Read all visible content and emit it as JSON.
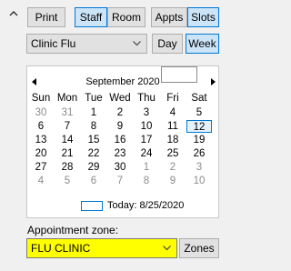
{
  "toolbar": {
    "print": "Print",
    "staff": "Staff",
    "room": "Room",
    "appts": "Appts",
    "slots": "Slots"
  },
  "filter": {
    "clinic": "Clinic Flu",
    "day": "Day",
    "week": "Week"
  },
  "calendar": {
    "month": "September 2020",
    "weekdays": [
      "Sun",
      "Mon",
      "Tue",
      "Wed",
      "Thu",
      "Fri",
      "Sat"
    ],
    "weeks": [
      [
        "30",
        "31",
        "1",
        "2",
        "3",
        "4",
        "5"
      ],
      [
        "6",
        "7",
        "8",
        "9",
        "10",
        "11",
        "12"
      ],
      [
        "13",
        "14",
        "15",
        "16",
        "17",
        "18",
        "19"
      ],
      [
        "20",
        "21",
        "22",
        "23",
        "24",
        "25",
        "26"
      ],
      [
        "27",
        "28",
        "29",
        "30",
        "1",
        "2",
        "3"
      ],
      [
        "4",
        "5",
        "6",
        "7",
        "8",
        "9",
        "10"
      ]
    ],
    "today": "Today: 8/25/2020"
  },
  "zone": {
    "label": "Appointment zone:",
    "value": "FLU CLINIC",
    "zones_button": "Zones",
    "highlight_color": "#ffff00"
  }
}
